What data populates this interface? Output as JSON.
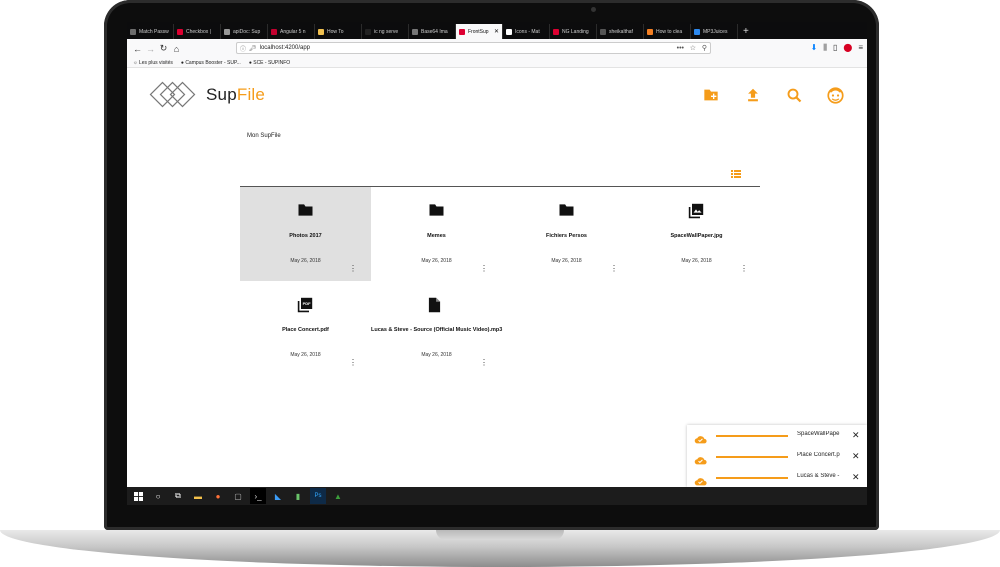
{
  "browser": {
    "tabs": [
      {
        "label": "Match Passw",
        "color": "#6d6d6d"
      },
      {
        "label": "Checkbox |",
        "color": "#dd0031"
      },
      {
        "label": "apiDoc: Sup",
        "color": "#999999"
      },
      {
        "label": "Angular 5 n",
        "color": "#c3002f"
      },
      {
        "label": "How To",
        "color": "#f0c050"
      },
      {
        "label": "ic ng serve",
        "color": "#222222"
      },
      {
        "label": "Base64 Ima",
        "color": "#777777"
      },
      {
        "label": "FrontSup",
        "color": "#dd0031",
        "active": true
      },
      {
        "label": "Icons - Mat",
        "color": "#ffffff"
      },
      {
        "label": "NG Landing",
        "color": "#dd0031"
      },
      {
        "label": "sheikalthaf",
        "color": "#555555"
      },
      {
        "label": "How to clea",
        "color": "#f48024"
      },
      {
        "label": "MP3Juices",
        "color": "#2d89ef"
      }
    ],
    "url": "localhost:4200/app",
    "bookmarks": [
      "Les plus visités",
      "Campus Booster - SUP...",
      "SCE - SUPINFO"
    ]
  },
  "app": {
    "brand": {
      "part1": "Sup",
      "part2": "File",
      "accent_color": "#f59c1a"
    },
    "toolbar_icons": [
      "create-folder-icon",
      "upload-icon",
      "search-icon",
      "profile-icon"
    ],
    "breadcrumb": "Mon SupFile",
    "files": [
      {
        "name": "Photos 2017",
        "date": "May 26, 2018",
        "icon": "folder-icon",
        "selected": true
      },
      {
        "name": "Memes",
        "date": "May 26, 2018",
        "icon": "folder-icon"
      },
      {
        "name": "Fichiers Persos",
        "date": "May 26, 2018",
        "icon": "folder-icon"
      },
      {
        "name": "SpaceWallPaper.jpg",
        "date": "May 26, 2018",
        "icon": "image-icon"
      },
      {
        "name": "Place Concert.pdf",
        "date": "May 26, 2018",
        "icon": "pdf-icon"
      },
      {
        "name": "Lucas & Steve - Source (Official Music Video).mp3",
        "date": "May 26, 2018",
        "icon": "file-icon"
      }
    ],
    "uploads": [
      {
        "name": "SpaceWallPape",
        "progress": 1.0
      },
      {
        "name": "Place Concert.p",
        "progress": 1.0
      },
      {
        "name": "Lucas & Steve -",
        "progress": 1.0
      }
    ]
  }
}
